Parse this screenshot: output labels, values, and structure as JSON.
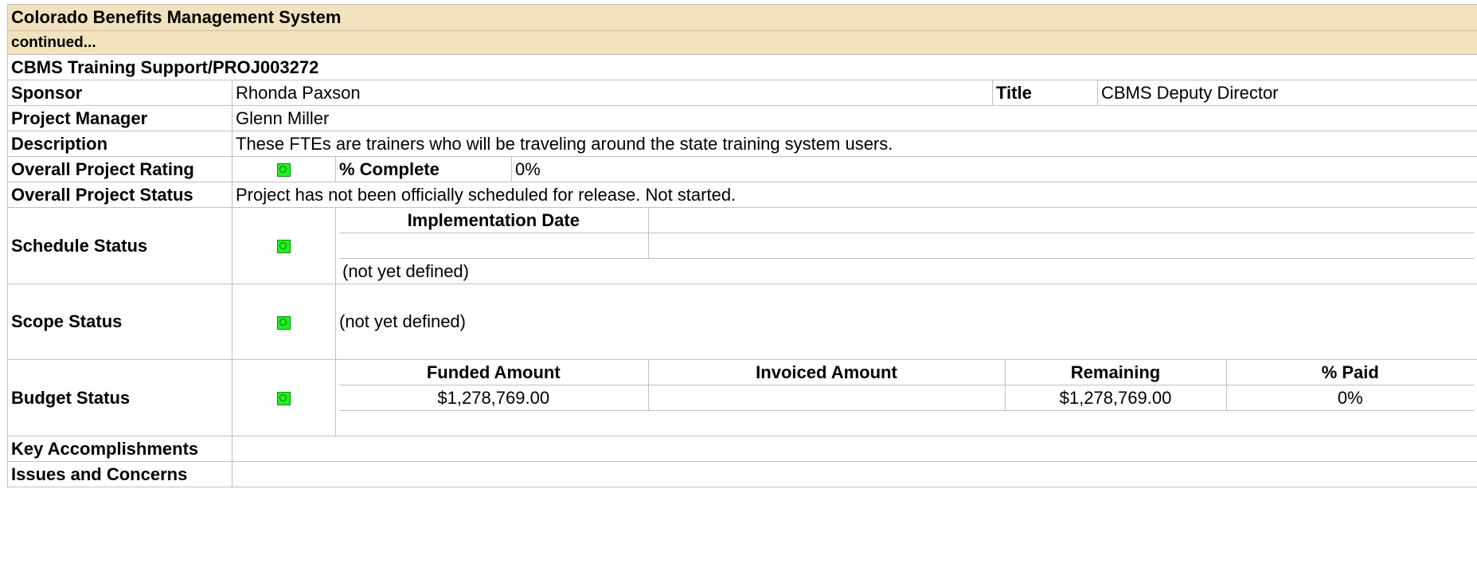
{
  "header": {
    "system_title": "Colorado Benefits Management System",
    "continued": "continued..."
  },
  "project": {
    "name": "CBMS Training Support/PROJ003272",
    "sponsor_label": "Sponsor",
    "sponsor": "Rhonda Paxson",
    "title_label": "Title",
    "title": "CBMS Deputy Director",
    "manager_label": "Project Manager",
    "manager": "Glenn Miller",
    "description_label": "Description",
    "description": "These FTEs are trainers who will be traveling around the state training system users."
  },
  "rating": {
    "label": "Overall Project Rating",
    "indicator": "green",
    "complete_label": "% Complete",
    "complete_value": "0%"
  },
  "overall_status": {
    "label": "Overall Project Status",
    "text": "Project has not been officially scheduled for release.  Not started."
  },
  "schedule": {
    "label": "Schedule Status",
    "indicator": "green",
    "impl_date_header": "Implementation Date",
    "impl_date_value": "",
    "note": "(not yet defined)"
  },
  "scope": {
    "label": "Scope Status",
    "indicator": "green",
    "note": "(not yet defined)"
  },
  "budget": {
    "label": "Budget Status",
    "indicator": "green",
    "headers": [
      "Funded Amount",
      "Invoiced Amount",
      "Remaining",
      "% Paid"
    ],
    "values": [
      "$1,278,769.00",
      "",
      "$1,278,769.00",
      "0%"
    ],
    "note": ""
  },
  "footer_rows": {
    "accomplishments_label": "Key Accomplishments",
    "accomplishments_value": "",
    "issues_label": "Issues and Concerns",
    "issues_value": ""
  },
  "colors": {
    "banner_bg": "#f2e2be",
    "status_green": "#22ee22",
    "border": "#c0c0c0"
  }
}
